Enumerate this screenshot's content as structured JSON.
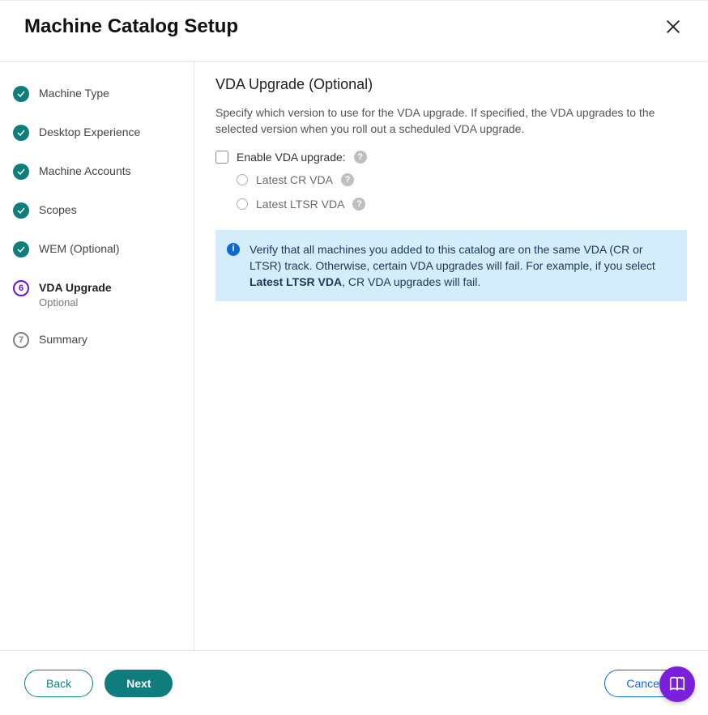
{
  "header": {
    "title": "Machine Catalog Setup"
  },
  "sidebar": {
    "steps": [
      {
        "label": "Machine Type",
        "state": "done"
      },
      {
        "label": "Desktop Experience",
        "state": "done"
      },
      {
        "label": "Machine Accounts",
        "state": "done"
      },
      {
        "label": "Scopes",
        "state": "done"
      },
      {
        "label": "WEM (Optional)",
        "state": "done"
      },
      {
        "label": "VDA Upgrade",
        "sublabel": "Optional",
        "state": "current",
        "num": "6"
      },
      {
        "label": "Summary",
        "state": "upcoming",
        "num": "7"
      }
    ]
  },
  "content": {
    "heading": "VDA Upgrade (Optional)",
    "description": "Specify which version to use for the VDA upgrade. If specified, the VDA upgrades to the selected version when you roll out a scheduled VDA upgrade.",
    "checkbox_label": "Enable VDA upgrade:",
    "radio1": "Latest CR VDA",
    "radio2": "Latest LTSR VDA",
    "info_pre": "Verify that all machines you added to this catalog are on the same VDA (CR or LTSR) track. Otherwise, certain VDA upgrades will fail. For example, if you select ",
    "info_bold": "Latest LTSR VDA",
    "info_post": ", CR VDA upgrades will fail."
  },
  "footer": {
    "back": "Back",
    "next": "Next",
    "cancel": "Cancel"
  }
}
